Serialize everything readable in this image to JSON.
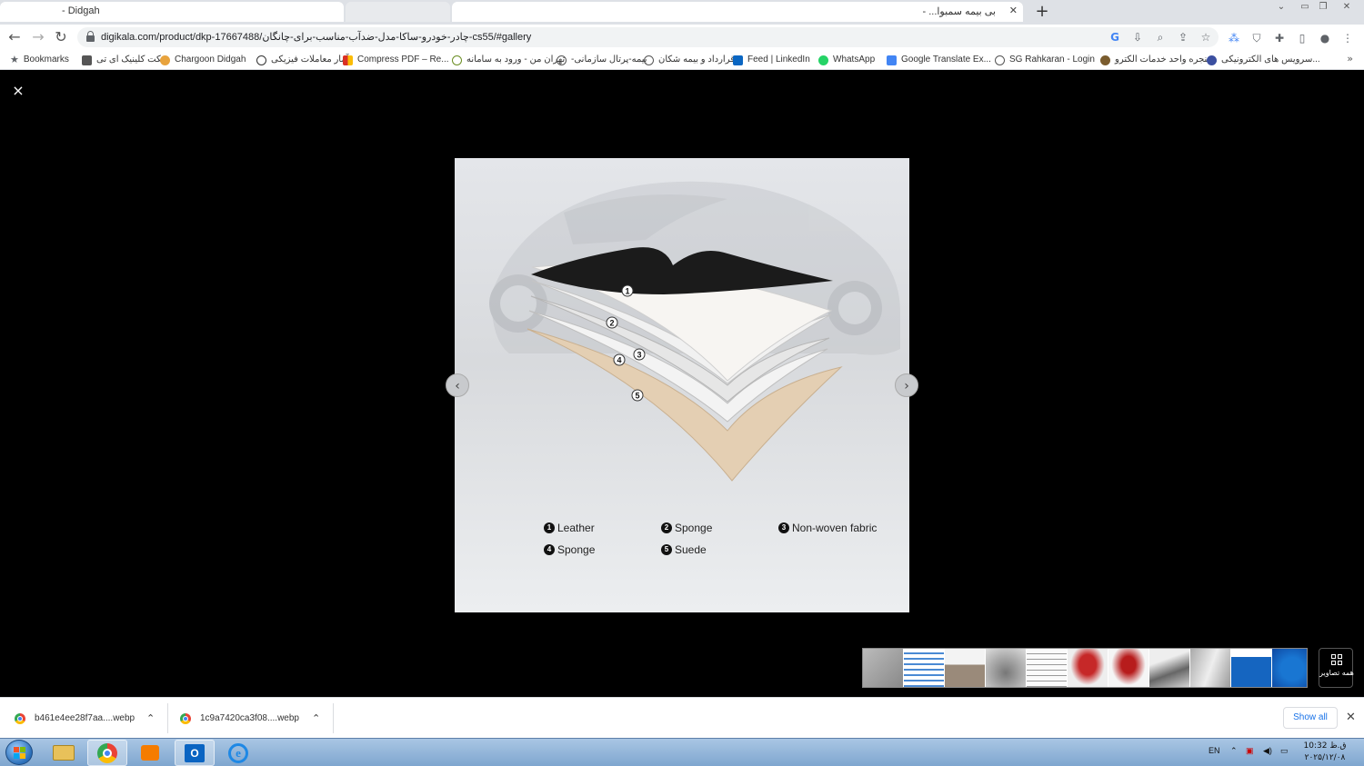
{
  "browser": {
    "tabs": [
      {
        "label": "- Didgah"
      },
      {
        "label": ""
      },
      {
        "label": ""
      },
      {
        "label": "- ...بی بیمه سمبوا"
      }
    ],
    "new_tab": "+",
    "url": "digikala.com/product/dkp-17667488/چادر-خودرو-ساکا-مدل-ضدآب-مناسب-برای-چانگان-cs55/#gallery"
  },
  "bookmarks": [
    {
      "label": "Bookmarks",
      "icon": "star-icon",
      "color": "#5f6368"
    },
    {
      "label": "تیکت کلینیک ای تی",
      "icon": "tool-icon",
      "color": "#555555"
    },
    {
      "label": "Chargoon Didgah",
      "icon": "chargoon-icon",
      "color": "#e8a33d"
    },
    {
      "label": "آمار معاملات فیزیکی",
      "icon": "circle-icon",
      "color": "#333333"
    },
    {
      "label": "Compress PDF – Re...",
      "icon": "pdf-icon",
      "color": "#d93025"
    },
    {
      "label": "تهران من - ورود به سامانه",
      "icon": "gear-icon",
      "color": "#6b8e23"
    },
    {
      "label": "-بیمه-پرتال سازمانی",
      "icon": "globe-icon",
      "color": "#555555"
    },
    {
      "label": "قرارداد و بیمه شکان",
      "icon": "globe-icon",
      "color": "#555555"
    },
    {
      "label": "Feed | LinkedIn",
      "icon": "linkedin-icon",
      "color": "#0a66c2"
    },
    {
      "label": "WhatsApp",
      "icon": "whatsapp-icon",
      "color": "#25d366"
    },
    {
      "label": "Google Translate Ex...",
      "icon": "translate-icon",
      "color": "#4285f4"
    },
    {
      "label": "SG Rahkaran - Login",
      "icon": "globe-icon",
      "color": "#555555"
    },
    {
      "label": "پنجره واحد خدمات الکترو...",
      "icon": "emblem-icon",
      "color": "#7a5c2e"
    },
    {
      "label": "سرویس های الکترونیکی...",
      "icon": "emblem-icon",
      "color": "#3b4fa0"
    }
  ],
  "gallery": {
    "close": "×",
    "prev": "‹",
    "next": "›",
    "legend": [
      {
        "num": "1",
        "label": "Leather"
      },
      {
        "num": "2",
        "label": "Sponge"
      },
      {
        "num": "3",
        "label": "Non-woven fabric"
      },
      {
        "num": "4",
        "label": "Sponge"
      },
      {
        "num": "5",
        "label": "Suede"
      }
    ],
    "layer_labels": [
      "1",
      "2",
      "3",
      "4",
      "5"
    ],
    "all_images_label": "همه تصاویر"
  },
  "downloads": {
    "items": [
      {
        "name": "b461e4ee28f7aa....webp"
      },
      {
        "name": "1c9a7420ca3f08....webp"
      }
    ],
    "show_all": "Show all",
    "close": "✕"
  },
  "taskbar": {
    "lang": "EN",
    "time": "10:32 ق.ظ",
    "date": "۲۰۲۵/۱۲/۰۸"
  }
}
